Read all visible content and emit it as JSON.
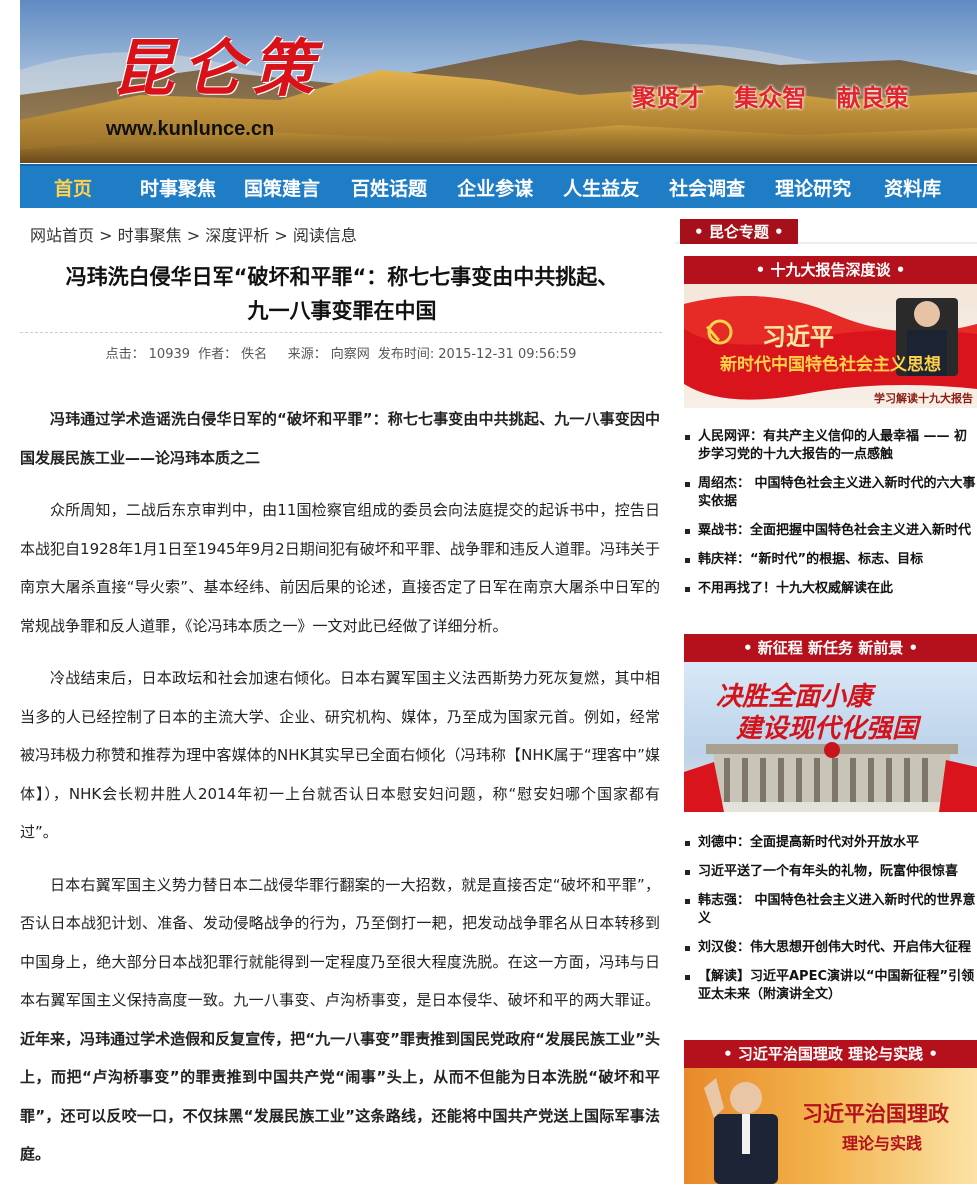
{
  "banner": {
    "logo_text": "昆仑策",
    "url": "www.kunlunce.cn",
    "slogans": [
      "聚贤才",
      "集众智",
      "献良策"
    ]
  },
  "nav": [
    "首页",
    "时事聚焦",
    "国策建言",
    "百姓话题",
    "企业参谋",
    "人生益友",
    "社会调查",
    "理论研究",
    "资料库"
  ],
  "breadcrumb": [
    "网站首页",
    "时事聚焦",
    "深度评析",
    "阅读信息"
  ],
  "breadcrumb_sep": ">",
  "article": {
    "title_line1": "冯玮洗白侵华日军“破坏和平罪“：称七七事变由中共挑起、",
    "title_line2": "九一八事变罪在中国",
    "meta": {
      "clicks_label": "点击：",
      "clicks": "10939",
      "author_label": "作者：",
      "author": "佚名",
      "source_label": "来源：",
      "source": "向察网",
      "time_label": "发布时间:",
      "time": "2015-12-31 09:56:59"
    },
    "lead": "冯玮通过学术造谣洗白侵华日军的“破坏和平罪”：称七七事变由中共挑起、九一八事变因中国发展民族工业——论冯玮本质之二",
    "p1": "众所周知，二战后东京审判中，由11国检察官组成的委员会向法庭提交的起诉书中，控告日本战犯自1928年1月1日至1945年9月2日期间犯有破坏和平罪、战争罪和违反人道罪。冯玮关于南京大屠杀直接“导火索”、基本经纬、前因后果的论述，直接否定了日军在南京大屠杀中日军的常规战争罪和反人道罪，《论冯玮本质之一》一文对此已经做了详细分析。",
    "p2": "冷战结束后，日本政坛和社会加速右倾化。日本右翼军国主义法西斯势力死灰复燃，其中相当多的人已经控制了日本的主流大学、企业、研究机构、媒体，乃至成为国家元首。例如，经常被冯玮极力称赞和推荐为理中客媒体的NHK其实早已全面右倾化（冯玮称【NHK属于“理客中”媒体】），NHK会长籾井胜人2014年初一上台就否认日本慰安妇问题，称“慰安妇哪个国家都有过”。",
    "p3_normal": "日本右翼军国主义势力替日本二战侵华罪行翻案的一大招数，就是直接否定“破坏和平罪”，否认日本战犯计划、准备、发动侵略战争的行为，乃至倒打一耙，把发动战争罪名从日本转移到中国身上，绝大部分日本战犯罪行就能得到一定程度乃至很大程度洗脱。在这一方面，冯玮与日本右翼军国主义保持高度一致。九一八事变、卢沟桥事变，是日本侵华、破坏和平的两大罪证。",
    "p3_bold": "近年来，冯玮通过学术造假和反复宣传，把“九一八事变”罪责推到国民党政府“发展民族工业”头上，而把“卢沟桥事变”的罪责推到中国共产党“闹事”头上，从而不但能为日本洗脱“破坏和平罪”，还可以反咬一口，不仅抹黑“发展民族工业”这条路线，还能将中国共产党送上国际军事法庭。"
  },
  "sidebar": {
    "tab": "昆仑专题",
    "sec1": {
      "heading": "十九大报告深度谈",
      "promo_title": "习近平",
      "promo_sub": "新时代中国特色社会主义思想",
      "promo_caption": "学习解读十九大报告",
      "links": [
        "人民网评：有共产主义信仰的人最幸福 —— 初步学习党的十九大报告的一点感触",
        "周绍杰：  中国特色社会主义进入新时代的六大事实依据",
        "粟战书：全面把握中国特色社会主义进入新时代",
        "韩庆祥：“新时代”的根据、标志、目标",
        "不用再找了！十九大权威解读在此"
      ]
    },
    "sec2": {
      "heading": "新征程 新任务 新前景",
      "promo_line1": "决胜全面小康",
      "promo_line2": "建设现代化强国",
      "links": [
        "刘德中：全面提高新时代对外开放水平",
        "习近平送了一个有年头的礼物，阮富仲很惊喜",
        "韩志强：  中国特色社会主义进入新时代的世界意义",
        "刘汉俊：伟大思想开创伟大时代、开启伟大征程",
        "【解读】习近平APEC演讲以“中国新征程”引领亚太未来（附演讲全文）"
      ]
    },
    "sec3": {
      "heading": "习近平治国理政 理论与实践",
      "promo_line1": "习近平治国理政",
      "promo_line2": "理论与实践"
    }
  },
  "colors": {
    "nav_bg": "#1f7dc6",
    "nav_active": "#ffd24a",
    "accent_red": "#b4111c",
    "logo_red": "#d9121a"
  }
}
